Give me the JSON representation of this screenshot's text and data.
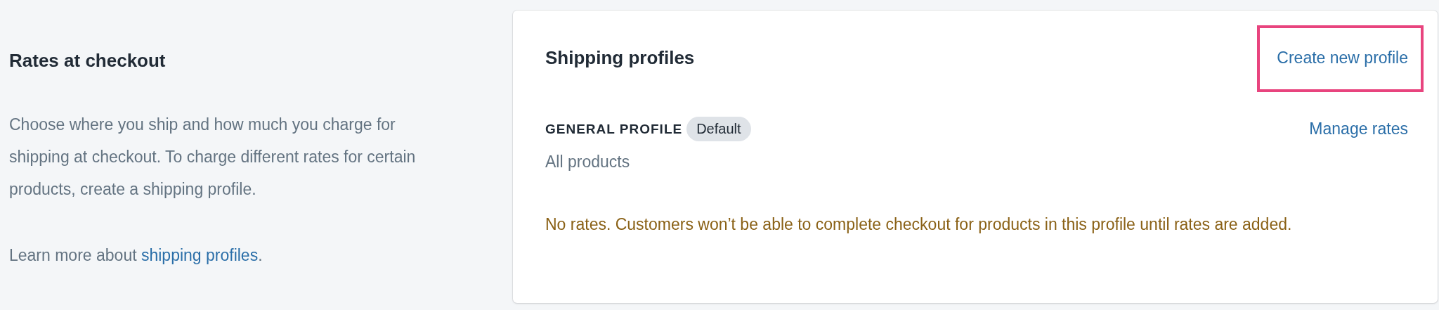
{
  "section": {
    "title": "Rates at checkout",
    "description": "Choose where you ship and how much you charge for shipping at checkout. To charge different rates for certain products, create a shipping profile.",
    "learn_more": {
      "text": "Learn more about ",
      "link": "shipping profiles",
      "suffix": "."
    }
  },
  "card": {
    "title": "Shipping profiles",
    "action": {
      "label": "Create new profile",
      "highlighted": true
    },
    "profile": {
      "name": "GENERAL PROFILE",
      "badge": "Default",
      "action": "Manage rates",
      "scope": "All products",
      "warning": "No rates. Customers won’t be able to complete checkout for products in this profile until rates are added."
    }
  }
}
